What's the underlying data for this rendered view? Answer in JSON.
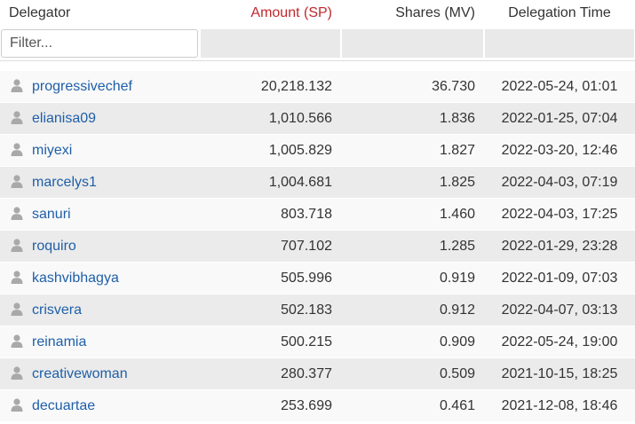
{
  "columns": {
    "delegator": "Delegator",
    "amount": "Amount (SP)",
    "shares": "Shares (MV)",
    "time": "Delegation Time"
  },
  "filter": {
    "placeholder": "Filter..."
  },
  "colors": {
    "amount_header": "#c0282d",
    "link": "#1f5fa8",
    "row_odd": "#f9f9f9",
    "row_even": "#ebebeb"
  },
  "icon": "user-icon",
  "rows": [
    {
      "name": "progressivechef",
      "amount": "20,218.132",
      "shares": "36.730",
      "time": "2022-05-24, 01:01"
    },
    {
      "name": "elianisa09",
      "amount": "1,010.566",
      "shares": "1.836",
      "time": "2022-01-25, 07:04"
    },
    {
      "name": "miyexi",
      "amount": "1,005.829",
      "shares": "1.827",
      "time": "2022-03-20, 12:46"
    },
    {
      "name": "marcelys1",
      "amount": "1,004.681",
      "shares": "1.825",
      "time": "2022-04-03, 07:19"
    },
    {
      "name": "sanuri",
      "amount": "803.718",
      "shares": "1.460",
      "time": "2022-04-03, 17:25"
    },
    {
      "name": "roquiro",
      "amount": "707.102",
      "shares": "1.285",
      "time": "2022-01-29, 23:28"
    },
    {
      "name": "kashvibhagya",
      "amount": "505.996",
      "shares": "0.919",
      "time": "2022-01-09, 07:03"
    },
    {
      "name": "crisvera",
      "amount": "502.183",
      "shares": "0.912",
      "time": "2022-04-07, 03:13"
    },
    {
      "name": "reinamia",
      "amount": "500.215",
      "shares": "0.909",
      "time": "2022-05-24, 19:00"
    },
    {
      "name": "creativewoman",
      "amount": "280.377",
      "shares": "0.509",
      "time": "2021-10-15, 18:25"
    },
    {
      "name": "decuartae",
      "amount": "253.699",
      "shares": "0.461",
      "time": "2021-12-08, 18:46"
    }
  ]
}
